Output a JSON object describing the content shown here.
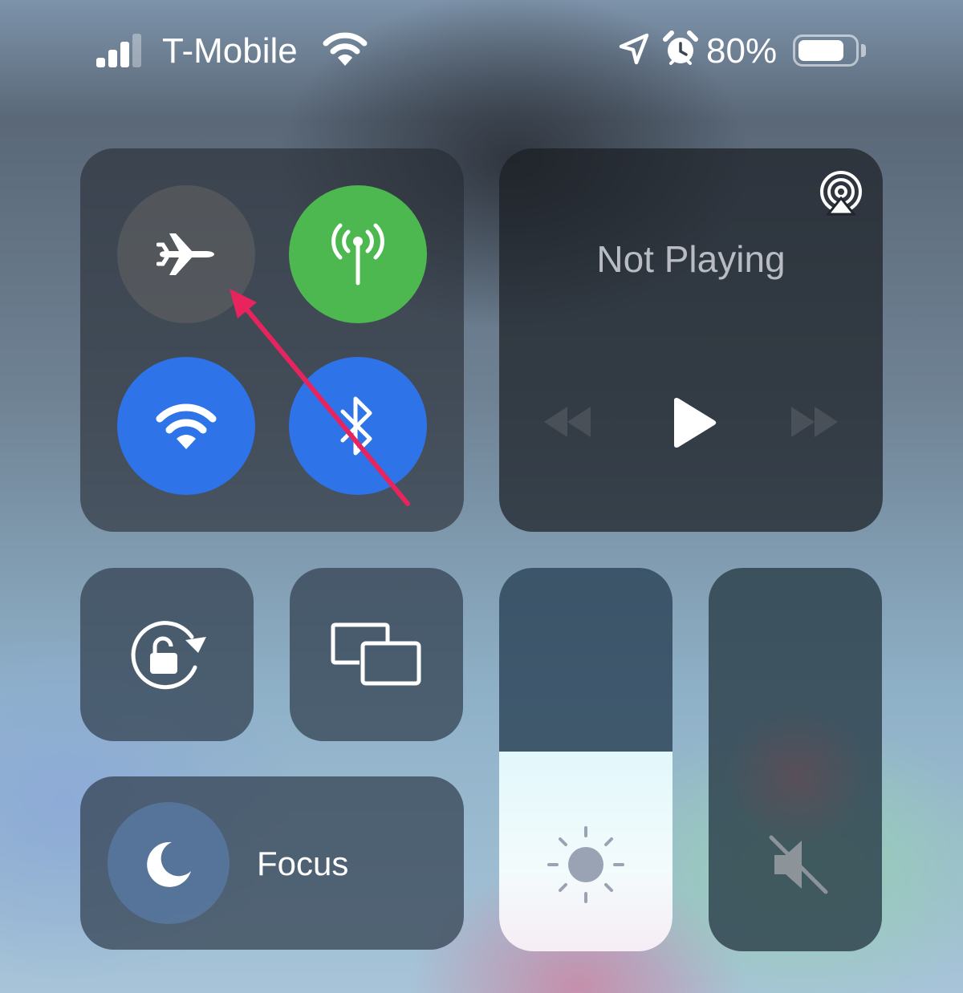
{
  "status_bar": {
    "carrier": "T-Mobile",
    "battery_percent": "80%",
    "battery_level": 0.8,
    "signal_bars": 3,
    "signal_bars_total": 4,
    "icons": [
      "cellular-signal-icon",
      "wifi-icon",
      "location-arrow-icon",
      "alarm-clock-icon",
      "battery-icon"
    ]
  },
  "connectivity": {
    "airplane_mode": {
      "icon": "airplane-icon",
      "state": "off"
    },
    "cellular_data": {
      "icon": "antenna-icon",
      "state": "on",
      "color": "#4cb84f"
    },
    "wifi": {
      "icon": "wifi-icon",
      "state": "on",
      "color": "#2f73e8"
    },
    "bluetooth": {
      "icon": "bluetooth-icon",
      "state": "on",
      "color": "#2f73e8"
    }
  },
  "media": {
    "status_text": "Not Playing",
    "icons": [
      "airplay-audio-icon",
      "rewind-icon",
      "play-icon",
      "fast-forward-icon"
    ]
  },
  "controls": {
    "rotation_lock": {
      "icon": "rotation-lock-icon"
    },
    "screen_mirroring": {
      "icon": "screen-mirroring-icon"
    },
    "focus": {
      "label": "Focus",
      "icon": "moon-icon"
    },
    "brightness": {
      "icon": "sun-icon",
      "level": 0.52
    },
    "volume": {
      "icon": "speaker-muted-icon",
      "level": 0
    }
  },
  "annotation": {
    "type": "arrow",
    "color": "#e8245e",
    "points_to": "airplane-mode-toggle"
  }
}
